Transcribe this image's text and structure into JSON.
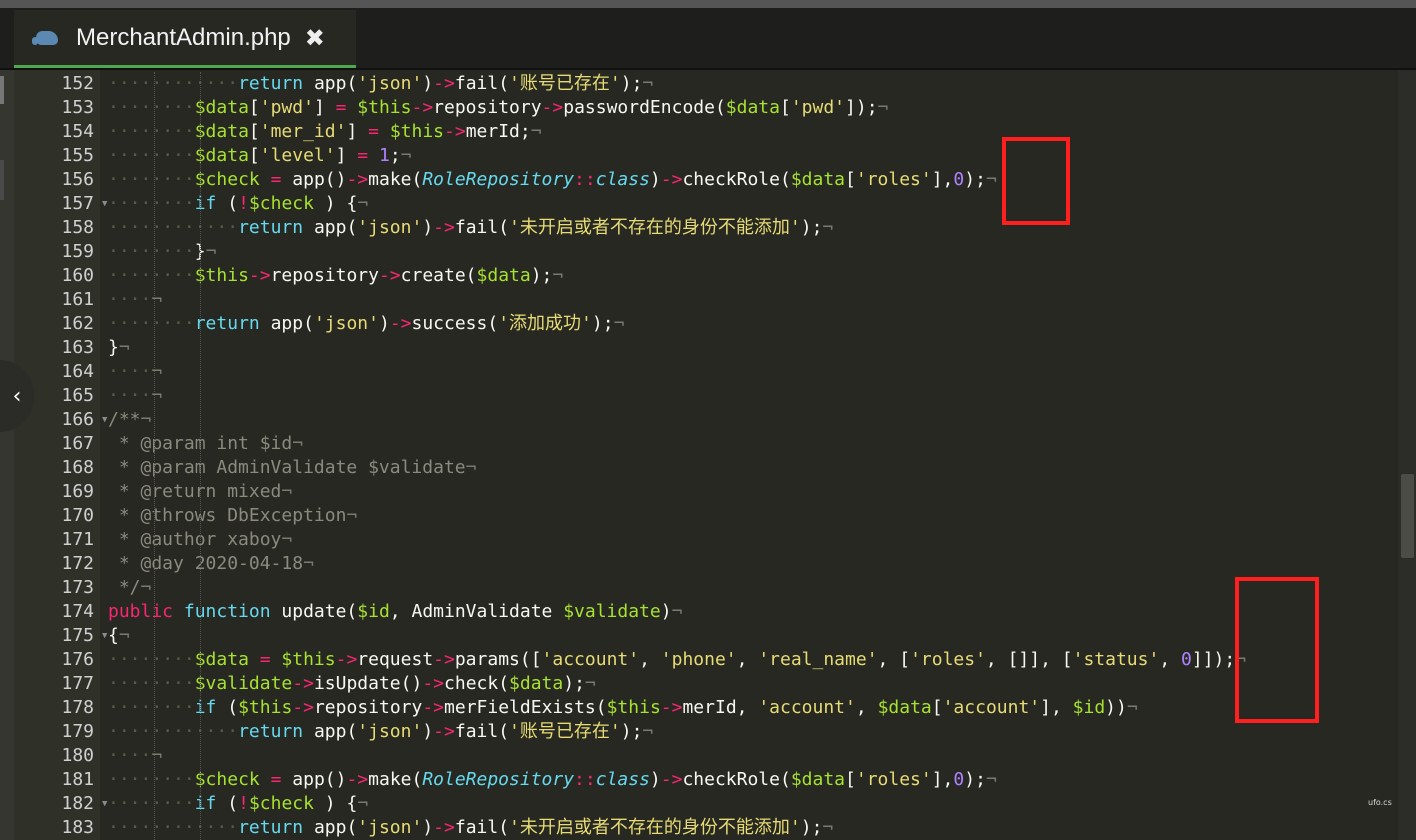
{
  "tab": {
    "title": "MerchantAdmin.php",
    "icon": "php-elephant-icon",
    "close_glyph": "✖"
  },
  "line_numbers": [
    "152",
    "153",
    "154",
    "155",
    "156",
    "157",
    "158",
    "159",
    "160",
    "161",
    "162",
    "163",
    "164",
    "165",
    "166",
    "167",
    "168",
    "169",
    "170",
    "171",
    "172",
    "173",
    "174",
    "175",
    "176",
    "177",
    "178",
    "179",
    "180",
    "181",
    "182",
    "183"
  ],
  "folds": [
    "157",
    "166",
    "175",
    "182"
  ],
  "code_lines": [
    {
      "ln": "152",
      "indent": 2,
      "parts": [
        [
          "kw",
          "return"
        ],
        [
          "fn",
          " app("
        ],
        [
          "str",
          "'json'"
        ],
        [
          "fn",
          ")"
        ],
        [
          "op",
          "->"
        ],
        [
          "fn",
          "fail("
        ],
        [
          "str",
          "'账号已存在'"
        ],
        [
          "fn",
          ");"
        ]
      ]
    },
    {
      "ln": "153",
      "indent": 1,
      "parts": [
        [
          "var",
          "$data"
        ],
        [
          "pun",
          "["
        ],
        [
          "str",
          "'pwd'"
        ],
        [
          "pun",
          "]"
        ],
        [
          "op",
          " = "
        ],
        [
          "var",
          "$this"
        ],
        [
          "op",
          "->"
        ],
        [
          "fn",
          "repository"
        ],
        [
          "op",
          "->"
        ],
        [
          "fn",
          "passwordEncode("
        ],
        [
          "var",
          "$data"
        ],
        [
          "pun",
          "["
        ],
        [
          "str",
          "'pwd'"
        ],
        [
          "pun",
          "]);"
        ]
      ]
    },
    {
      "ln": "154",
      "indent": 1,
      "parts": [
        [
          "var",
          "$data"
        ],
        [
          "pun",
          "["
        ],
        [
          "str",
          "'mer_id'"
        ],
        [
          "pun",
          "]"
        ],
        [
          "op",
          " = "
        ],
        [
          "var",
          "$this"
        ],
        [
          "op",
          "->"
        ],
        [
          "fn",
          "merId;"
        ]
      ]
    },
    {
      "ln": "155",
      "indent": 1,
      "parts": [
        [
          "var",
          "$data"
        ],
        [
          "pun",
          "["
        ],
        [
          "str",
          "'level'"
        ],
        [
          "pun",
          "]"
        ],
        [
          "op",
          " = "
        ],
        [
          "num",
          "1"
        ],
        [
          "pun",
          ";"
        ]
      ]
    },
    {
      "ln": "156",
      "indent": 1,
      "parts": [
        [
          "var",
          "$check"
        ],
        [
          "op",
          " = "
        ],
        [
          "fn",
          "app()"
        ],
        [
          "op",
          "->"
        ],
        [
          "fn",
          "make("
        ],
        [
          "cls",
          "RoleRepository"
        ],
        [
          "op",
          "::"
        ],
        [
          "cls",
          "class"
        ],
        [
          "fn",
          ")"
        ],
        [
          "op",
          "->"
        ],
        [
          "fn",
          "checkRole("
        ],
        [
          "var",
          "$data"
        ],
        [
          "pun",
          "["
        ],
        [
          "str",
          "'roles'"
        ],
        [
          "pun",
          "],"
        ],
        [
          "num",
          "0"
        ],
        [
          "pun",
          ");"
        ]
      ]
    },
    {
      "ln": "157",
      "indent": 1,
      "parts": [
        [
          "kw",
          "if"
        ],
        [
          "pun",
          " ("
        ],
        [
          "op",
          "!"
        ],
        [
          "var",
          "$check"
        ],
        [
          "pun",
          " ) {"
        ]
      ]
    },
    {
      "ln": "158",
      "indent": 2,
      "parts": [
        [
          "kw",
          "return"
        ],
        [
          "fn",
          " app("
        ],
        [
          "str",
          "'json'"
        ],
        [
          "fn",
          ")"
        ],
        [
          "op",
          "->"
        ],
        [
          "fn",
          "fail("
        ],
        [
          "str",
          "'未开启或者不存在的身份不能添加'"
        ],
        [
          "fn",
          ");"
        ]
      ]
    },
    {
      "ln": "159",
      "indent": 1,
      "parts": [
        [
          "pun",
          "}"
        ]
      ]
    },
    {
      "ln": "160",
      "indent": 1,
      "parts": [
        [
          "var",
          "$this"
        ],
        [
          "op",
          "->"
        ],
        [
          "fn",
          "repository"
        ],
        [
          "op",
          "->"
        ],
        [
          "fn",
          "create("
        ],
        [
          "var",
          "$data"
        ],
        [
          "pun",
          ");"
        ]
      ]
    },
    {
      "ln": "161",
      "indent": 0,
      "parts": []
    },
    {
      "ln": "162",
      "indent": 1,
      "parts": [
        [
          "kw",
          "return"
        ],
        [
          "fn",
          " app("
        ],
        [
          "str",
          "'json'"
        ],
        [
          "fn",
          ")"
        ],
        [
          "op",
          "->"
        ],
        [
          "fn",
          "success("
        ],
        [
          "str",
          "'添加成功'"
        ],
        [
          "fn",
          ");"
        ]
      ]
    },
    {
      "ln": "163",
      "indent": 0,
      "pre": 1,
      "parts": [
        [
          "pun",
          "}"
        ]
      ]
    },
    {
      "ln": "164",
      "indent": 0,
      "parts": []
    },
    {
      "ln": "165",
      "indent": 0,
      "parts": []
    },
    {
      "ln": "166",
      "indent": 0,
      "pre": 1,
      "parts": [
        [
          "cm",
          "/**"
        ]
      ]
    },
    {
      "ln": "167",
      "indent": 0,
      "pre": 1,
      "parts": [
        [
          "cm",
          " * @param int $id"
        ]
      ]
    },
    {
      "ln": "168",
      "indent": 0,
      "pre": 1,
      "parts": [
        [
          "cm",
          " * @param AdminValidate $validate"
        ]
      ]
    },
    {
      "ln": "169",
      "indent": 0,
      "pre": 1,
      "parts": [
        [
          "cm",
          " * @return mixed"
        ]
      ]
    },
    {
      "ln": "170",
      "indent": 0,
      "pre": 1,
      "parts": [
        [
          "cm",
          " * @throws DbException"
        ]
      ]
    },
    {
      "ln": "171",
      "indent": 0,
      "pre": 1,
      "parts": [
        [
          "cm",
          " * @author xaboy"
        ]
      ]
    },
    {
      "ln": "172",
      "indent": 0,
      "pre": 1,
      "parts": [
        [
          "cm",
          " * @day 2020-04-18"
        ]
      ]
    },
    {
      "ln": "173",
      "indent": 0,
      "pre": 1,
      "parts": [
        [
          "cm",
          " */"
        ]
      ]
    },
    {
      "ln": "174",
      "indent": 0,
      "pre": 1,
      "parts": [
        [
          "op",
          "public"
        ],
        [
          "pun",
          " "
        ],
        [
          "kw",
          "function"
        ],
        [
          "fn",
          " update("
        ],
        [
          "var",
          "$id"
        ],
        [
          "pun",
          ", "
        ],
        [
          "fn",
          "AdminValidate "
        ],
        [
          "var",
          "$validate"
        ],
        [
          "pun",
          ")"
        ]
      ]
    },
    {
      "ln": "175",
      "indent": 0,
      "pre": 1,
      "parts": [
        [
          "pun",
          "{"
        ]
      ]
    },
    {
      "ln": "176",
      "indent": 1,
      "parts": [
        [
          "var",
          "$data"
        ],
        [
          "op",
          " = "
        ],
        [
          "var",
          "$this"
        ],
        [
          "op",
          "->"
        ],
        [
          "fn",
          "request"
        ],
        [
          "op",
          "->"
        ],
        [
          "fn",
          "params(["
        ],
        [
          "str",
          "'account'"
        ],
        [
          "pun",
          ", "
        ],
        [
          "str",
          "'phone'"
        ],
        [
          "pun",
          ", "
        ],
        [
          "str",
          "'real_name'"
        ],
        [
          "pun",
          ", ["
        ],
        [
          "str",
          "'roles'"
        ],
        [
          "pun",
          ", []], ["
        ],
        [
          "str",
          "'status'"
        ],
        [
          "pun",
          ", "
        ],
        [
          "num",
          "0"
        ],
        [
          "pun",
          "]]);"
        ]
      ]
    },
    {
      "ln": "177",
      "indent": 1,
      "parts": [
        [
          "var",
          "$validate"
        ],
        [
          "op",
          "->"
        ],
        [
          "fn",
          "isUpdate()"
        ],
        [
          "op",
          "->"
        ],
        [
          "fn",
          "check("
        ],
        [
          "var",
          "$data"
        ],
        [
          "pun",
          ");"
        ]
      ]
    },
    {
      "ln": "178",
      "indent": 1,
      "parts": [
        [
          "kw",
          "if"
        ],
        [
          "pun",
          " ("
        ],
        [
          "var",
          "$this"
        ],
        [
          "op",
          "->"
        ],
        [
          "fn",
          "repository"
        ],
        [
          "op",
          "->"
        ],
        [
          "fn",
          "merFieldExists("
        ],
        [
          "var",
          "$this"
        ],
        [
          "op",
          "->"
        ],
        [
          "fn",
          "merId, "
        ],
        [
          "str",
          "'account'"
        ],
        [
          "pun",
          ", "
        ],
        [
          "var",
          "$data"
        ],
        [
          "pun",
          "["
        ],
        [
          "str",
          "'account'"
        ],
        [
          "pun",
          "], "
        ],
        [
          "var",
          "$id"
        ],
        [
          "pun",
          "))"
        ]
      ]
    },
    {
      "ln": "179",
      "indent": 2,
      "parts": [
        [
          "kw",
          "return"
        ],
        [
          "fn",
          " app("
        ],
        [
          "str",
          "'json'"
        ],
        [
          "fn",
          ")"
        ],
        [
          "op",
          "->"
        ],
        [
          "fn",
          "fail("
        ],
        [
          "str",
          "'账号已存在'"
        ],
        [
          "fn",
          ");"
        ]
      ]
    },
    {
      "ln": "180",
      "indent": 0,
      "parts": []
    },
    {
      "ln": "181",
      "indent": 1,
      "parts": [
        [
          "var",
          "$check"
        ],
        [
          "op",
          " = "
        ],
        [
          "fn",
          "app()"
        ],
        [
          "op",
          "->"
        ],
        [
          "fn",
          "make("
        ],
        [
          "cls",
          "RoleRepository"
        ],
        [
          "op",
          "::"
        ],
        [
          "cls",
          "class"
        ],
        [
          "fn",
          ")"
        ],
        [
          "op",
          "->"
        ],
        [
          "fn",
          "checkRole("
        ],
        [
          "var",
          "$data"
        ],
        [
          "pun",
          "["
        ],
        [
          "str",
          "'roles'"
        ],
        [
          "pun",
          "],"
        ],
        [
          "num",
          "0"
        ],
        [
          "pun",
          ");"
        ]
      ]
    },
    {
      "ln": "182",
      "indent": 1,
      "parts": [
        [
          "kw",
          "if"
        ],
        [
          "pun",
          " ("
        ],
        [
          "op",
          "!"
        ],
        [
          "var",
          "$check"
        ],
        [
          "pun",
          " ) {"
        ]
      ]
    },
    {
      "ln": "183",
      "indent": 2,
      "parts": [
        [
          "kw",
          "return"
        ],
        [
          "fn",
          " app("
        ],
        [
          "str",
          "'json'"
        ],
        [
          "fn",
          ")"
        ],
        [
          "op",
          "->"
        ],
        [
          "fn",
          "fail("
        ],
        [
          "str",
          "'未开启或者不存在的身份不能添加'"
        ],
        [
          "fn",
          ");"
        ]
      ]
    }
  ],
  "whitespace_glyphs": {
    "indent_dot": "····",
    "eol": "¬"
  },
  "colors": {
    "highlight_box": "#ff1f1f",
    "background": "#272822",
    "tab_accent": "#4fa84f"
  },
  "brand_mark": "ufo.cs",
  "collapse_glyph": "‹"
}
